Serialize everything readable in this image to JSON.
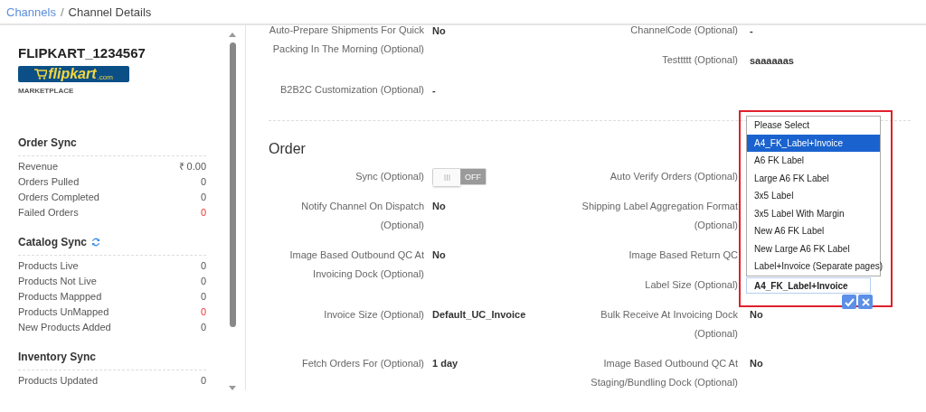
{
  "breadcrumb": [
    {
      "label": "Channels",
      "kind": "link"
    },
    {
      "label": "/",
      "kind": "separator"
    },
    {
      "label": "Channel Details",
      "kind": "current"
    }
  ],
  "sidebar": {
    "title": "FLIPKART_1234567",
    "logo": {
      "name": "flipkart",
      "suffix": ".com"
    },
    "type": "MARKETPLACE",
    "sections": [
      {
        "title": "Order Sync",
        "refresh": false,
        "rows": [
          {
            "label": "Revenue",
            "value": "₹ 0.00",
            "alert": false
          },
          {
            "label": "Orders Pulled",
            "value": "0",
            "alert": false
          },
          {
            "label": "Orders Completed",
            "value": "0",
            "alert": false
          },
          {
            "label": "Failed Orders",
            "value": "0",
            "alert": true
          }
        ]
      },
      {
        "title": "Catalog Sync",
        "refresh": true,
        "rows": [
          {
            "label": "Products Live",
            "value": "0",
            "alert": false
          },
          {
            "label": "Products Not Live",
            "value": "0",
            "alert": false
          },
          {
            "label": "Products Mappped",
            "value": "0",
            "alert": false
          },
          {
            "label": "Products UnMapped",
            "value": "0",
            "alert": true
          },
          {
            "label": "New Products Added",
            "value": "0",
            "alert": false
          }
        ]
      },
      {
        "title": "Inventory Sync",
        "refresh": false,
        "rows": [
          {
            "label": "Products Updated",
            "value": "0",
            "alert": false
          }
        ]
      }
    ]
  },
  "top_fields": {
    "left": [
      {
        "label": "Auto-Prepare Shipments For Quick Packing In The Morning (Optional)",
        "value": "No",
        "kind": "text"
      },
      {
        "label": "B2B2C Customization (Optional)",
        "value": "-",
        "kind": "text"
      }
    ],
    "right": [
      {
        "label": "ChannelCode (Optional)",
        "value": "-",
        "kind": "text"
      },
      {
        "label": "Testtttt (Optional)",
        "value": "saaaaaas",
        "kind": "text"
      }
    ]
  },
  "order": {
    "title": "Order",
    "left": [
      {
        "label": "Sync (Optional)",
        "kind": "toggle",
        "on": false,
        "toggle_text": "OFF"
      },
      {
        "label": "Notify Channel On Dispatch (Optional)",
        "value": "No",
        "kind": "text"
      },
      {
        "label": "Image Based Outbound QC At Invoicing Dock (Optional)",
        "value": "No",
        "kind": "text"
      },
      {
        "label": "Invoice Size (Optional)",
        "value": "Default_UC_Invoice",
        "kind": "text"
      },
      {
        "label": "Fetch Orders For (Optional)",
        "value": "1 day",
        "kind": "text"
      }
    ],
    "right": [
      {
        "label": "Auto Verify Orders (Optional)",
        "kind": "label"
      },
      {
        "label": "Shipping Label Aggregation Format (Optional)",
        "kind": "label"
      },
      {
        "label": "Image Based Return QC",
        "kind": "label"
      },
      {
        "label": "Label Size (Optional)",
        "kind": "select"
      },
      {
        "label": "Bulk Receive At Invoicing Dock (Optional)",
        "value": "No",
        "kind": "text"
      },
      {
        "label": "Image Based Outbound QC At Staging/Bundling Dock (Optional)",
        "value": "No",
        "kind": "text"
      }
    ]
  },
  "label_size_editor": {
    "options": [
      {
        "label": "Please Select",
        "selected": false
      },
      {
        "label": "A4_FK_Label+Invoice",
        "selected": true
      },
      {
        "label": "A6 FK Label",
        "selected": false
      },
      {
        "label": "Large A6 FK Label",
        "selected": false
      },
      {
        "label": "3x5 Label",
        "selected": false
      },
      {
        "label": "3x5 Label With Margin",
        "selected": false
      },
      {
        "label": "New A6 FK Label",
        "selected": false
      },
      {
        "label": "New Large A6 FK Label",
        "selected": false
      },
      {
        "label": "Label+Invoice (Separate pages)",
        "selected": false
      }
    ],
    "value": "A4_FK_Label+Invoice"
  }
}
